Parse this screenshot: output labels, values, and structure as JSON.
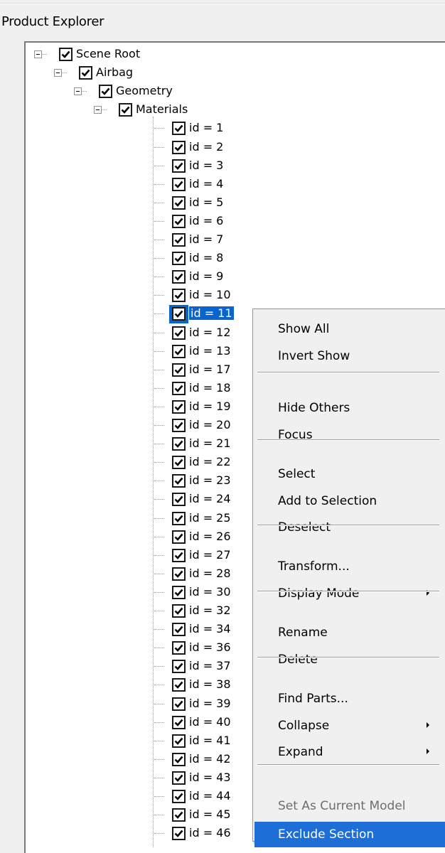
{
  "panel": {
    "title": "Product Explorer"
  },
  "tree": {
    "nodes": [
      {
        "label": "Scene Root",
        "depth": 0,
        "expander": true
      },
      {
        "label": "Airbag",
        "depth": 1,
        "expander": true
      },
      {
        "label": "Geometry",
        "depth": 2,
        "expander": true
      },
      {
        "label": "Materials",
        "depth": 3,
        "expander": true
      }
    ],
    "items": [
      "id = 1",
      "id = 2",
      "id = 3",
      "id = 4",
      "id = 5",
      "id = 6",
      "id = 7",
      "id = 8",
      "id = 9",
      "id = 10",
      "id = 11",
      "id = 12",
      "id = 13",
      "id = 17",
      "id = 18",
      "id = 19",
      "id = 20",
      "id = 21",
      "id = 22",
      "id = 23",
      "id = 24",
      "id = 25",
      "id = 26",
      "id = 27",
      "id = 28",
      "id = 30",
      "id = 32",
      "id = 34",
      "id = 36",
      "id = 37",
      "id = 38",
      "id = 39",
      "id = 40",
      "id = 41",
      "id = 42",
      "id = 43",
      "id = 44",
      "id = 45",
      "id = 46"
    ],
    "selected_item": "id = 11",
    "checkbox_icon": "checkmark-icon",
    "expander_icon": "collapse-minus-icon"
  },
  "context_menu": {
    "groups": [
      [
        {
          "label": "Show All"
        },
        {
          "label": "Invert Show"
        }
      ],
      [
        {
          "label": "Hide Others"
        },
        {
          "label": "Focus"
        }
      ],
      [
        {
          "label": "Select"
        },
        {
          "label": "Add to Selection"
        },
        {
          "label": "Deselect"
        }
      ],
      [
        {
          "label": "Transform..."
        },
        {
          "label": "Display Mode",
          "submenu": true
        }
      ],
      [
        {
          "label": "Rename"
        },
        {
          "label": "Delete"
        }
      ],
      [
        {
          "label": "Find Parts..."
        },
        {
          "label": "Collapse",
          "submenu": true
        },
        {
          "label": "Expand",
          "submenu": true
        }
      ],
      [
        {
          "label": "Set As Current Model",
          "disabled": true
        },
        {
          "label": "Exclude Section",
          "highlight": true
        }
      ]
    ]
  },
  "colors": {
    "selection": "#0a64d0",
    "menu_highlight": "#1e6ed8",
    "disabled_text": "#6d6d6d"
  }
}
